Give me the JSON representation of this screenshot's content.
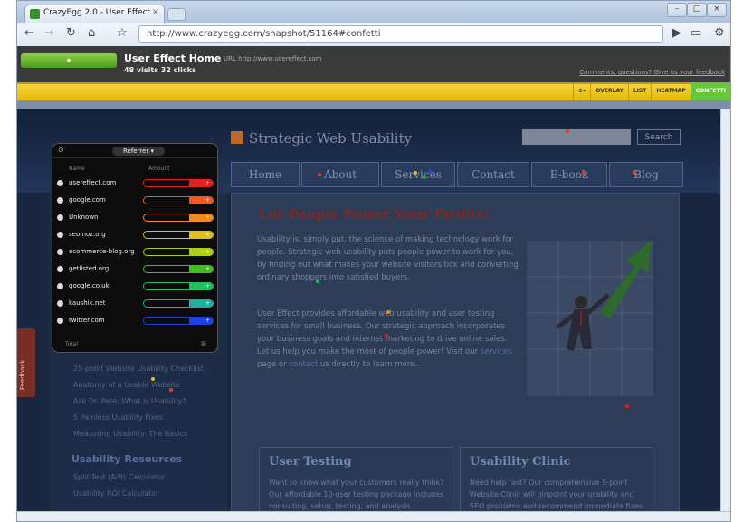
{
  "browser": {
    "tab_title": "CrazyEgg 2.0 - User Effect...",
    "url": "http://www.crazyegg.com/snapshot/51164#confetti",
    "url_prefix": "http://",
    "back_icon": "arrow-left",
    "forward_icon": "arrow-right",
    "reload_icon": "reload",
    "home_icon": "home",
    "star_icon": "star"
  },
  "crazyegg": {
    "title": "User Effect Home",
    "title_url": "URL http://www.usereffect.com",
    "stats": "48 visits  32 clicks",
    "help": "Comments, questions? Give us your feedback",
    "tools": [
      "OVERLAY",
      "LIST",
      "HEATMAP",
      "CONFETTI"
    ]
  },
  "site": {
    "title": "Strategic Web Usability",
    "search_button": "Search",
    "nav": [
      "Home",
      "About",
      "Services",
      "Contact",
      "E-book",
      "Blog"
    ],
    "headline": "Let People Power Your Profits!",
    "para1": "Usability is, simply put, the science of making technology work for people. Strategic web usability puts people power to work for you, by finding out what makes your website visitors tick and converting ordinary shoppers into satisfied buyers.",
    "para2_start": "User Effect provides affordable web usability and user testing services for small business. Our strategic approach incorporates your business goals and internet marketing to drive online sales. Let us help you make the most of people power! Visit our",
    "para2_link1": "services",
    "para2_mid": "page or",
    "para2_link2": "contact",
    "para2_end": "us directly to learn more.",
    "card1_title": "User Testing",
    "card1_text": "Want to know what your customers really think? Our affordable 10-user testing package includes consulting, setup, testing, and analysis.",
    "card2_title": "Usability Clinic",
    "card2_text": "Need help fast? Our comprehensive 5-point Website Clinic will pinpoint your usability and SEO problems and recommend immediate fixes.",
    "side_links": [
      "25-point Website Usability Checklist",
      "Anatomy of a Usable Website",
      "Ask Dr. Pete: What is Usability?",
      "5 Painless Usability Fixes",
      "Measuring Usability: The Basics"
    ],
    "side_heading": "Usability Resources",
    "side_links2": [
      "Split-Test (A/B) Calculator",
      "Usability ROI Calculator"
    ],
    "feedback": "Feedback"
  },
  "panel": {
    "selector": "Referrer",
    "col_name": "Name",
    "col_amount": "Amount",
    "rows": [
      {
        "name": "usereffect.com",
        "color": "#e02020"
      },
      {
        "name": "google.com",
        "color": "#f05a20"
      },
      {
        "name": "Unknown",
        "color": "#f08a20"
      },
      {
        "name": "seomoz.org",
        "color": "#e0c020"
      },
      {
        "name": "ecommerce-blog.org",
        "color": "#b0d020"
      },
      {
        "name": "getlisted.org",
        "color": "#40c020"
      },
      {
        "name": "google.co.uk",
        "color": "#20c060"
      },
      {
        "name": "kaushik.net",
        "color": "#20b0a0"
      },
      {
        "name": "twitter.com",
        "color": "#2040e0"
      }
    ],
    "footer": "Total"
  }
}
